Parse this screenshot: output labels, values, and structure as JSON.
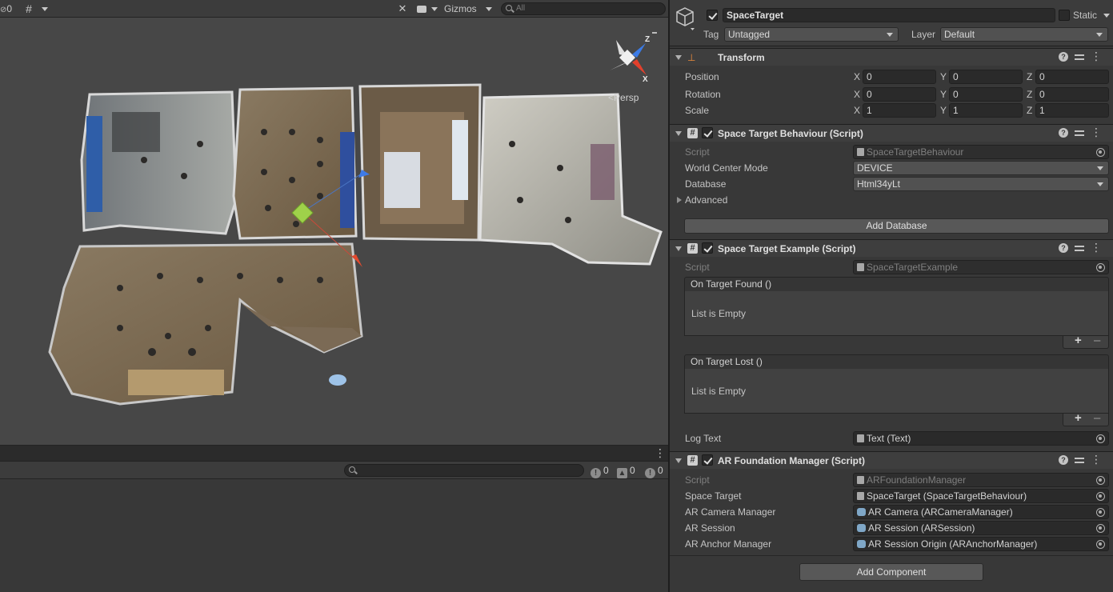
{
  "scene": {
    "toolbar": {
      "hidden_layers_count": "0",
      "gizmos_label": "Gizmos",
      "search_placeholder": "All"
    },
    "persp_label": "Persp",
    "gizmo_axes": {
      "z": "Z",
      "x": "X"
    }
  },
  "console": {
    "error_count": "0",
    "warning_count": "0",
    "info_count": "0"
  },
  "inspector": {
    "object": {
      "name": "SpaceTarget",
      "static_label": "Static",
      "tag_label": "Tag",
      "tag_value": "Untagged",
      "layer_label": "Layer",
      "layer_value": "Default"
    },
    "transform": {
      "title": "Transform",
      "position_label": "Position",
      "rotation_label": "Rotation",
      "scale_label": "Scale",
      "axes": [
        "X",
        "Y",
        "Z"
      ],
      "position": [
        "0",
        "0",
        "0"
      ],
      "rotation": [
        "0",
        "0",
        "0"
      ],
      "scale": [
        "1",
        "1",
        "1"
      ]
    },
    "space_target_behaviour": {
      "title": "Space Target Behaviour (Script)",
      "script_label": "Script",
      "script_value": "SpaceTargetBehaviour",
      "world_center_mode_label": "World Center Mode",
      "world_center_mode_value": "DEVICE",
      "database_label": "Database",
      "database_value": "Html34yLt",
      "advanced_label": "Advanced",
      "add_database_label": "Add Database"
    },
    "space_target_example": {
      "title": "Space Target Example (Script)",
      "script_label": "Script",
      "script_value": "SpaceTargetExample",
      "on_target_found_label": "On Target Found ()",
      "on_target_lost_label": "On Target Lost ()",
      "list_empty_text": "List is Empty",
      "log_text_label": "Log Text",
      "log_text_value": "Text (Text)"
    },
    "ar_foundation_manager": {
      "title": "AR Foundation Manager (Script)",
      "script_label": "Script",
      "script_value": "ARFoundationManager",
      "space_target_label": "Space Target",
      "space_target_value": "SpaceTarget (SpaceTargetBehaviour)",
      "ar_camera_manager_label": "AR Camera Manager",
      "ar_camera_manager_value": "AR Camera (ARCameraManager)",
      "ar_session_label": "AR Session",
      "ar_session_value": "AR Session (ARSession)",
      "ar_anchor_manager_label": "AR Anchor Manager",
      "ar_anchor_manager_value": "AR Session Origin (ARAnchorManager)"
    },
    "add_component_label": "Add Component"
  }
}
